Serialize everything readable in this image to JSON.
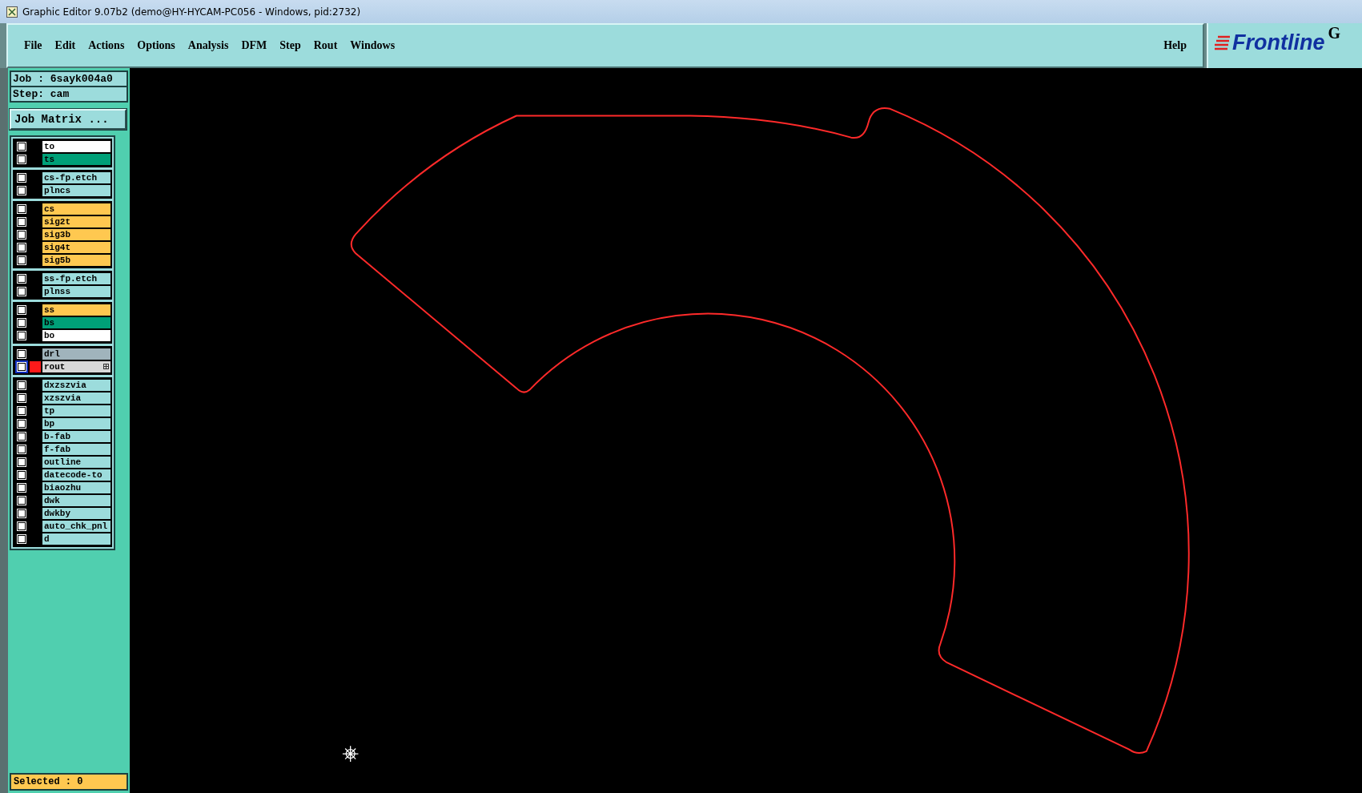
{
  "window": {
    "title": "Graphic Editor 9.07b2 (demo@HY-HYCAM-PC056 - Windows, pid:2732)"
  },
  "menu": [
    "File",
    "Edit",
    "Actions",
    "Options",
    "Analysis",
    "DFM",
    "Step",
    "Rout",
    "Windows"
  ],
  "help": "Help",
  "logo": {
    "text": "Frontline",
    "suffix": "G"
  },
  "job": {
    "job": "Job : 6sayk004a0",
    "step": "Step: cam"
  },
  "job_matrix_button": "Job Matrix ...",
  "layer_groups": [
    {
      "layers": [
        {
          "name": "to",
          "color": "#ffffff",
          "selected": false,
          "marked": false,
          "checked": false
        },
        {
          "name": "ts",
          "color": "#00a078",
          "selected": false,
          "marked": false,
          "checked": false
        }
      ]
    },
    {
      "layers": [
        {
          "name": "cs-fp.etch",
          "color": "#9cdcdc",
          "selected": false,
          "marked": false,
          "checked": false
        },
        {
          "name": "plncs",
          "color": "#9cdcdc",
          "selected": false,
          "marked": false,
          "checked": false
        }
      ]
    },
    {
      "layers": [
        {
          "name": "cs",
          "color": "#ffc850",
          "selected": false,
          "marked": false,
          "checked": false
        },
        {
          "name": "sig2t",
          "color": "#ffc850",
          "selected": false,
          "marked": false,
          "checked": false
        },
        {
          "name": "sig3b",
          "color": "#ffc850",
          "selected": false,
          "marked": false,
          "checked": false
        },
        {
          "name": "sig4t",
          "color": "#ffc850",
          "selected": false,
          "marked": false,
          "checked": false
        },
        {
          "name": "sig5b",
          "color": "#ffc850",
          "selected": false,
          "marked": false,
          "checked": false
        }
      ]
    },
    {
      "layers": [
        {
          "name": "ss-fp.etch",
          "color": "#9cdcdc",
          "selected": false,
          "marked": false,
          "checked": false
        },
        {
          "name": "plnss",
          "color": "#9cdcdc",
          "selected": false,
          "marked": false,
          "checked": false
        }
      ]
    },
    {
      "layers": [
        {
          "name": "ss",
          "color": "#ffc850",
          "selected": false,
          "marked": false,
          "checked": false
        },
        {
          "name": "bs",
          "color": "#00a078",
          "selected": false,
          "marked": false,
          "checked": false
        },
        {
          "name": "bo",
          "color": "#ffffff",
          "selected": false,
          "marked": false,
          "checked": false
        }
      ]
    },
    {
      "layers": [
        {
          "name": "drl",
          "color": "#a0b4bc",
          "selected": false,
          "marked": false,
          "checked": false
        },
        {
          "name": "rout",
          "color": "#d8d8d8",
          "selected": true,
          "marked": true,
          "checked": false
        }
      ]
    },
    {
      "layers": [
        {
          "name": "dxzszvia",
          "color": "#9cdcdc",
          "selected": false,
          "marked": false,
          "checked": false
        },
        {
          "name": "xzszvia",
          "color": "#9cdcdc",
          "selected": false,
          "marked": false,
          "checked": false
        },
        {
          "name": "tp",
          "color": "#9cdcdc",
          "selected": false,
          "marked": false,
          "checked": false
        },
        {
          "name": "bp",
          "color": "#9cdcdc",
          "selected": false,
          "marked": false,
          "checked": false
        },
        {
          "name": "b-fab",
          "color": "#9cdcdc",
          "selected": false,
          "marked": false,
          "checked": false
        },
        {
          "name": "f-fab",
          "color": "#9cdcdc",
          "selected": false,
          "marked": false,
          "checked": false
        },
        {
          "name": "outline",
          "color": "#9cdcdc",
          "selected": false,
          "marked": false,
          "checked": false
        },
        {
          "name": "datecode-to",
          "color": "#9cdcdc",
          "selected": false,
          "marked": false,
          "checked": false
        },
        {
          "name": "biaozhu",
          "color": "#9cdcdc",
          "selected": false,
          "marked": false,
          "checked": false
        },
        {
          "name": "dwk",
          "color": "#9cdcdc",
          "selected": false,
          "marked": false,
          "checked": false
        },
        {
          "name": "dwkby",
          "color": "#9cdcdc",
          "selected": false,
          "marked": false,
          "checked": false
        },
        {
          "name": "auto_chk_pnl",
          "color": "#9cdcdc",
          "selected": false,
          "marked": false,
          "checked": false
        },
        {
          "name": "d",
          "color": "#9cdcdc",
          "selected": false,
          "marked": false,
          "checked": false
        }
      ]
    }
  ],
  "selected_count": "Selected : 0"
}
